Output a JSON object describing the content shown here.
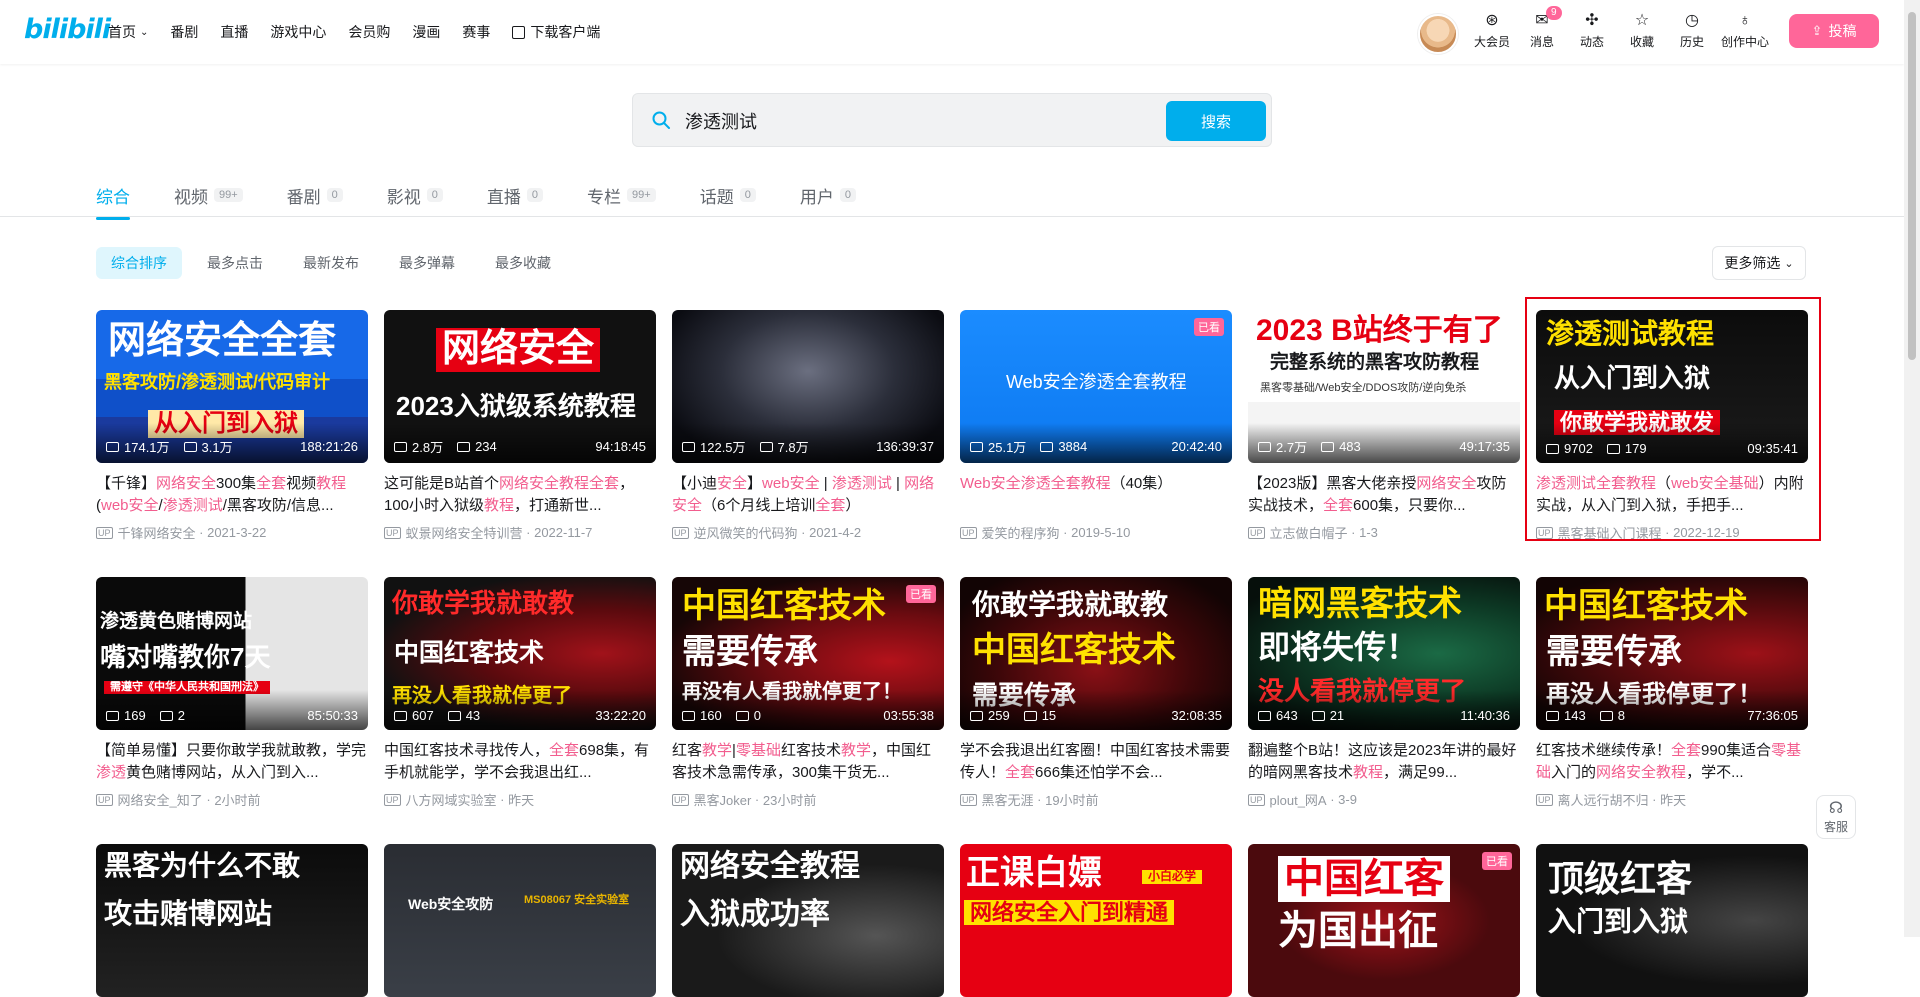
{
  "header": {
    "logo": "bilibili",
    "nav": [
      {
        "label": "首页",
        "has_dropdown": true
      },
      {
        "label": "番剧"
      },
      {
        "label": "直播"
      },
      {
        "label": "游戏中心"
      },
      {
        "label": "会员购"
      },
      {
        "label": "漫画"
      },
      {
        "label": "赛事"
      },
      {
        "label": "下载客户端",
        "icon": "download-icon"
      }
    ],
    "right": [
      {
        "label": "大会员",
        "icon": "vip-icon"
      },
      {
        "label": "消息",
        "icon": "message-icon",
        "badge": "9"
      },
      {
        "label": "动态",
        "icon": "dynamic-icon"
      },
      {
        "label": "收藏",
        "icon": "star-icon"
      },
      {
        "label": "历史",
        "icon": "clock-icon"
      },
      {
        "label": "创作中心",
        "icon": "bulb-icon"
      }
    ],
    "upload_label": "投稿"
  },
  "search": {
    "value": "渗透测试",
    "button": "搜索"
  },
  "tabs": [
    {
      "label": "综合",
      "count": ""
    },
    {
      "label": "视频",
      "count": "99+"
    },
    {
      "label": "番剧",
      "count": "0"
    },
    {
      "label": "影视",
      "count": "0"
    },
    {
      "label": "直播",
      "count": "0"
    },
    {
      "label": "专栏",
      "count": "99+"
    },
    {
      "label": "话题",
      "count": "0"
    },
    {
      "label": "用户",
      "count": "0"
    }
  ],
  "sorts": [
    "综合排序",
    "最多点击",
    "最新发布",
    "最多弹幕",
    "最多收藏"
  ],
  "more_filter": "更多筛选",
  "help_label": "客服",
  "colors": {
    "accent": "#00aeec",
    "pink": "#ff6699",
    "highlight": "#f25d8e",
    "red_box": "#e60012"
  },
  "videos": [
    {
      "plays": "174.1万",
      "danmaku": "3.1万",
      "duration": "188:21:26",
      "title": "【千锋】网络安全300集全套视频教程(web安全/渗透测试/黑客攻防/信息...",
      "uploader": "千锋网络安全",
      "date": "2021-3-22",
      "thumb_lines": [
        "网络安全全套",
        "黑客攻防/渗透测试/代码审计",
        "从入门到入狱"
      ]
    },
    {
      "plays": "2.8万",
      "danmaku": "234",
      "duration": "94:18:45",
      "title": "这可能是B站首个网络安全教程全套，100小时入狱级教程，打通新世...",
      "uploader": "蚁景网络安全特训营",
      "date": "2022-11-7",
      "thumb_lines": [
        "网络安全",
        "2023入狱级系统教程"
      ]
    },
    {
      "plays": "122.5万",
      "danmaku": "7.8万",
      "duration": "136:39:37",
      "title": "【小迪安全】web安全 | 渗透测试 | 网络安全（6个月线上培训全套）",
      "uploader": "逆风微笑的代码狗",
      "date": "2021-4-2",
      "thumb_lines": []
    },
    {
      "plays": "25.1万",
      "danmaku": "3884",
      "duration": "20:42:40",
      "title": "Web安全渗透全套教程（40集）",
      "uploader": "爱笑的程序狗",
      "date": "2019-5-10",
      "thumb_lines": [
        "Web安全渗透全套教程"
      ],
      "mark": "已看"
    },
    {
      "plays": "2.7万",
      "danmaku": "483",
      "duration": "49:17:35",
      "title": "【2023版】黑客大佬亲授网络安全攻防实战技术，全套600集，只要你...",
      "uploader": "立志做白帽子",
      "date": "1-3",
      "thumb_lines": [
        "2023 B站终于有了",
        "完整系统的黑客攻防教程",
        "黑客零基础/Web安全/DDOS攻防/逆向免杀"
      ]
    },
    {
      "plays": "9702",
      "danmaku": "179",
      "duration": "09:35:41",
      "title": "渗透测试全套教程（web安全基础）内附实战，从入门到入狱，手把手...",
      "uploader": "黑客基础入门课程",
      "date": "2022-12-19",
      "thumb_lines": [
        "渗透测试教程",
        "从入门到入狱",
        "你敢学我就敢发"
      ]
    },
    {
      "plays": "169",
      "danmaku": "2",
      "duration": "85:50:33",
      "title": "【简单易懂】只要你敢学我就敢教，学完渗透黄色赌博网站，从入门到入...",
      "uploader": "网络安全_知了",
      "date": "2小时前",
      "thumb_lines": [
        "渗透黄色赌博网站",
        "嘴对嘴教你7天",
        "需遵守《中华人民共和国刑法》"
      ]
    },
    {
      "plays": "607",
      "danmaku": "43",
      "duration": "33:22:20",
      "title": "中国红客技术寻找传人，全套698集，有手机就能学，学不会我退出红...",
      "uploader": "八方网域实验室",
      "date": "昨天",
      "thumb_lines": [
        "你敢学我就敢教",
        "中国红客技术",
        "再没人看我就停更了"
      ]
    },
    {
      "plays": "160",
      "danmaku": "0",
      "duration": "03:55:38",
      "title": "红客教学|零基础红客技术教学，中国红客技术急需传承，300集干货无...",
      "uploader": "黑客Joker",
      "date": "23小时前",
      "thumb_lines": [
        "中国红客技术",
        "需要传承",
        "再没有人看我就停更了！"
      ],
      "mark": "已看"
    },
    {
      "plays": "259",
      "danmaku": "15",
      "duration": "32:08:35",
      "title": "学不会我退出红客圈！中国红客技术需要传人！全套666集还怕学不会...",
      "uploader": "黑客无涯",
      "date": "19小时前",
      "thumb_lines": [
        "你敢学我就敢教",
        "中国红客技术",
        "需要传承"
      ]
    },
    {
      "plays": "643",
      "danmaku": "21",
      "duration": "11:40:36",
      "title": "翻遍整个B站！这应该是2023年讲的最好的暗网黑客技术教程，满足99...",
      "uploader": "plout_网A",
      "date": "3-9",
      "thumb_lines": [
        "暗网黑客技术",
        "即将失传！",
        "没人看我就停更了"
      ]
    },
    {
      "plays": "143",
      "danmaku": "8",
      "duration": "77:36:05",
      "title": "红客技术继续传承！全套990集适合零基础入门的网络安全教程，学不...",
      "uploader": "离人远行胡不归",
      "date": "昨天",
      "thumb_lines": [
        "中国红客技术",
        "需要传承",
        "再没人看我停更了！"
      ]
    },
    {
      "thumb_lines": [
        "黑客为什么不敢",
        "攻击赌博网站"
      ]
    },
    {
      "thumb_lines": [
        "Web安全攻防",
        "MS08067 安全实验室"
      ]
    },
    {
      "thumb_lines": [
        "网络安全教程",
        "入狱成功率"
      ]
    },
    {
      "thumb_lines": [
        "正课白嫖",
        "网络安全入门到精通",
        "小白必学"
      ]
    },
    {
      "thumb_lines": [
        "中国红客",
        "为国出征"
      ],
      "mark": "已看"
    },
    {
      "thumb_lines": [
        "顶级红客",
        "入门到入狱"
      ]
    }
  ]
}
